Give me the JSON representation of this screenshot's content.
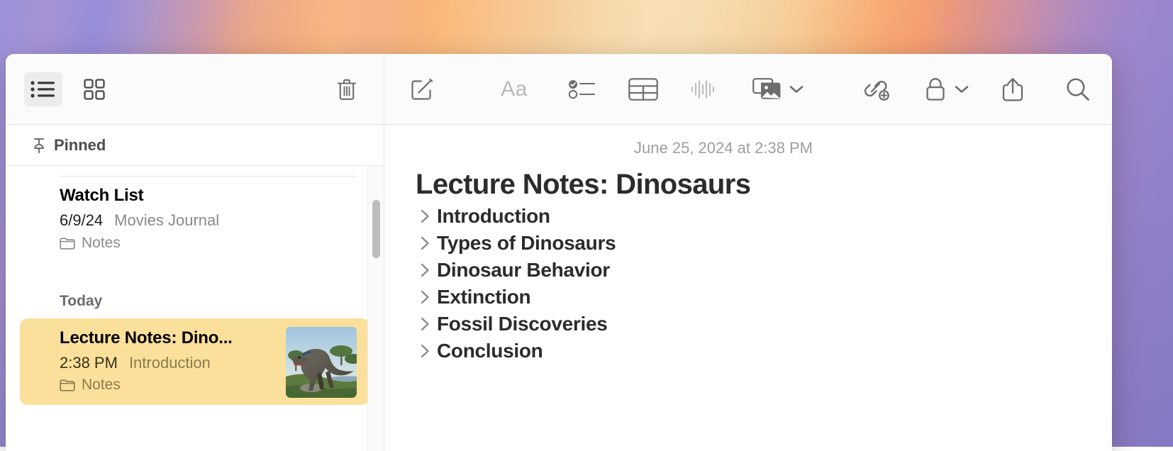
{
  "app": {
    "name": "Notes"
  },
  "toolbar": {
    "list_view_label": "list-view",
    "gallery_view_label": "gallery-view",
    "delete_label": "Delete",
    "compose_label": "New Note",
    "format_label": "Aa",
    "checklist_label": "Checklist",
    "table_label": "Table",
    "audio_label": "Audio",
    "media_label": "Media",
    "media_chevron": "chevron-down",
    "link_label": "Add Link",
    "lock_label": "Lock",
    "lock_chevron": "chevron-down",
    "share_label": "Share",
    "search_label": "Search"
  },
  "notelist": {
    "pinned_header": "Pinned",
    "groups": [
      {
        "header": "",
        "notes": [
          {
            "title": "Watch List",
            "date": "6/9/24",
            "snippet": "Movies Journal",
            "folder": "Notes",
            "selected": false,
            "has_thumbnail": false
          }
        ]
      },
      {
        "header": "Today",
        "notes": [
          {
            "title": "Lecture Notes: Dino...",
            "date": "2:38 PM",
            "snippet": "Introduction",
            "folder": "Notes",
            "selected": true,
            "has_thumbnail": true,
            "thumbnail_alt": "tyrannosaurus-rex-in-jungle"
          }
        ]
      }
    ]
  },
  "note": {
    "timestamp": "June 25, 2024 at 2:38 PM",
    "title": "Lecture Notes: Dinosaurs",
    "headings": [
      {
        "text": "Introduction",
        "collapsed": true
      },
      {
        "text": "Types of Dinosaurs",
        "collapsed": true
      },
      {
        "text": "Dinosaur Behavior",
        "collapsed": true
      },
      {
        "text": "Extinction",
        "collapsed": true
      },
      {
        "text": "Fossil Discoveries",
        "collapsed": true
      },
      {
        "text": "Conclusion",
        "collapsed": true
      }
    ]
  },
  "colors": {
    "selected_note_bg": "#fae09a",
    "toolbar_bg": "#fbfbfb",
    "icon_gray": "#6d6d70",
    "text_primary": "#2c2c2e",
    "text_secondary": "#8a8a8e"
  }
}
